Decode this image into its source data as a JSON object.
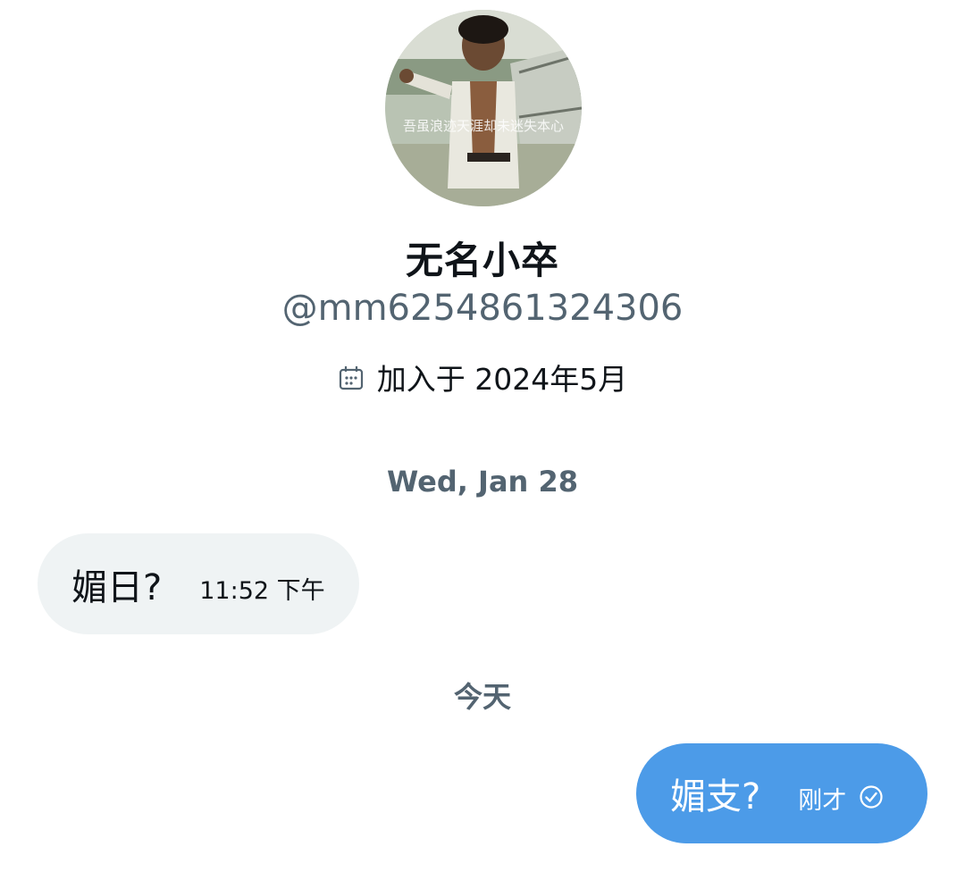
{
  "profile": {
    "display_name": "无名小卒",
    "handle": "@mm6254861324306",
    "joined": "加入于 2024年5月",
    "avatar_caption": "吾虽浪迹天涯却未迷失本心"
  },
  "conversation": {
    "date_separator_1": "Wed, Jan 28",
    "incoming": {
      "text": "媚日?",
      "time": "11:52 下午"
    },
    "date_separator_2": "今天",
    "outgoing": {
      "text": "媚支?",
      "time": "刚才",
      "status_icon": "sent-check-icon"
    }
  },
  "colors": {
    "outgoing_bubble": "#4c9be8",
    "incoming_bubble": "#eff3f4",
    "secondary_text": "#536471",
    "primary_text": "#0f1419"
  }
}
